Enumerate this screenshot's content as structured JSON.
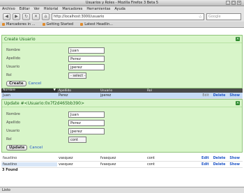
{
  "window": {
    "title": "Usuarios y Roles - Mozilla Firefox 3 Beta 5"
  },
  "menu": [
    "Archivo",
    "Editar",
    "Ver",
    "Historial",
    "Marcadores",
    "Herramientas",
    "Ayuda"
  ],
  "nav": {
    "url": "http://localhost:3000/usuario",
    "search_placeholder": "Google"
  },
  "bookmarks": [
    "Marcadores in ...",
    "Getting Started",
    "Latest Headlin..."
  ],
  "create_form": {
    "title": "Create Usuario",
    "fields": [
      {
        "label": "Nombre",
        "value": "Juan"
      },
      {
        "label": "Apellido",
        "value": "Perez"
      },
      {
        "label": "Usuario",
        "value": "jperez"
      }
    ],
    "rol_label": "Rol",
    "rol_value": "- select -",
    "create_label": "Create",
    "cancel_label": "Cancel"
  },
  "table": {
    "headers": [
      "Nombre",
      "Apellido",
      "Usuario",
      "Rol"
    ],
    "rows": [
      {
        "nombre": "Juan",
        "apellido": "Perez",
        "usuario": "jperez",
        "rol": ""
      },
      {
        "nombre": "faustino",
        "apellido": "vasquez",
        "usuario": "fvasquez",
        "rol": "cont"
      },
      {
        "nombre": "faustino",
        "apellido": "vasquez",
        "usuario": "fvasquez",
        "rol": "cont"
      }
    ],
    "action_edit": "Edit",
    "action_delete": "Delete",
    "action_show": "Show",
    "found": "3 Found"
  },
  "update_form": {
    "title": "Update #<Usuario:0x7f2d465bb390>",
    "fields": [
      {
        "label": "Nombre",
        "value": "Juan"
      },
      {
        "label": "Apellido",
        "value": "Perez"
      },
      {
        "label": "Usuario",
        "value": "jperez"
      }
    ],
    "rol_label": "Rol",
    "rol_value": "cont",
    "update_label": "Update",
    "cancel_label": "Cancel"
  },
  "status": "Listo"
}
